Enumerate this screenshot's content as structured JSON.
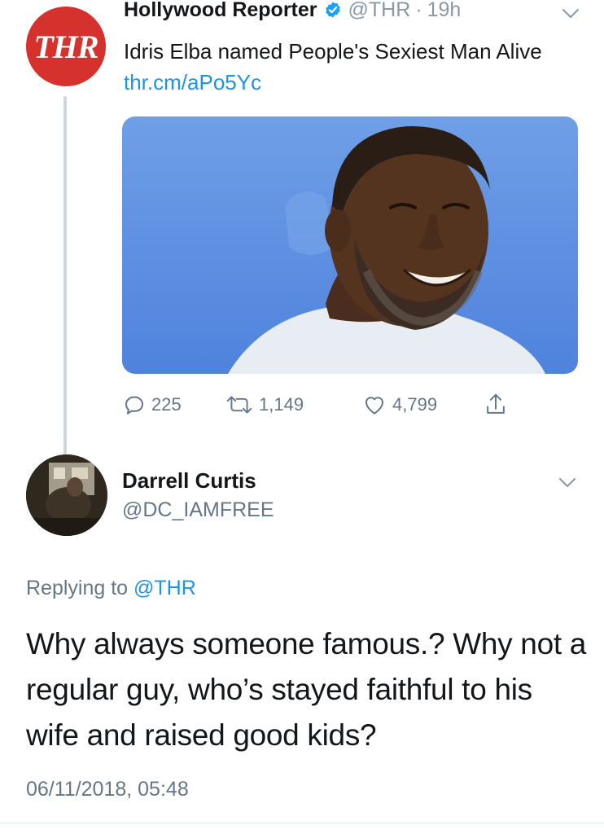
{
  "tweet1": {
    "avatar_text": "THR",
    "name": "Hollywood Reporter",
    "handle": "@THR",
    "separator": "·",
    "time": "19h",
    "text": "Idris Elba named People's Sexiest Man Alive",
    "link": "thr.cm/aPo5Yc",
    "icons": {
      "verified": "verified-badge-icon",
      "menu": "chevron-down-icon",
      "reply": "reply-icon",
      "retweet": "retweet-icon",
      "like": "heart-icon",
      "share": "share-icon"
    },
    "stats": {
      "replies": "225",
      "retweets": "1,149",
      "likes": "4,799"
    }
  },
  "tweet2": {
    "name": "Darrell Curtis",
    "handle": "@DC_IAMFREE",
    "replying_label": "Replying to",
    "replying_to": "@THR",
    "text": "Why always someone famous.? Why not a regular guy, who’s stayed faithful to his wife and raised good kids?",
    "timestamp": "06/11/2018, 05:48"
  },
  "colors": {
    "brand_red": "#d6322d",
    "link_blue": "#1b95e0",
    "muted_gray": "#657786",
    "photo_blue": "#5d8fe2"
  }
}
